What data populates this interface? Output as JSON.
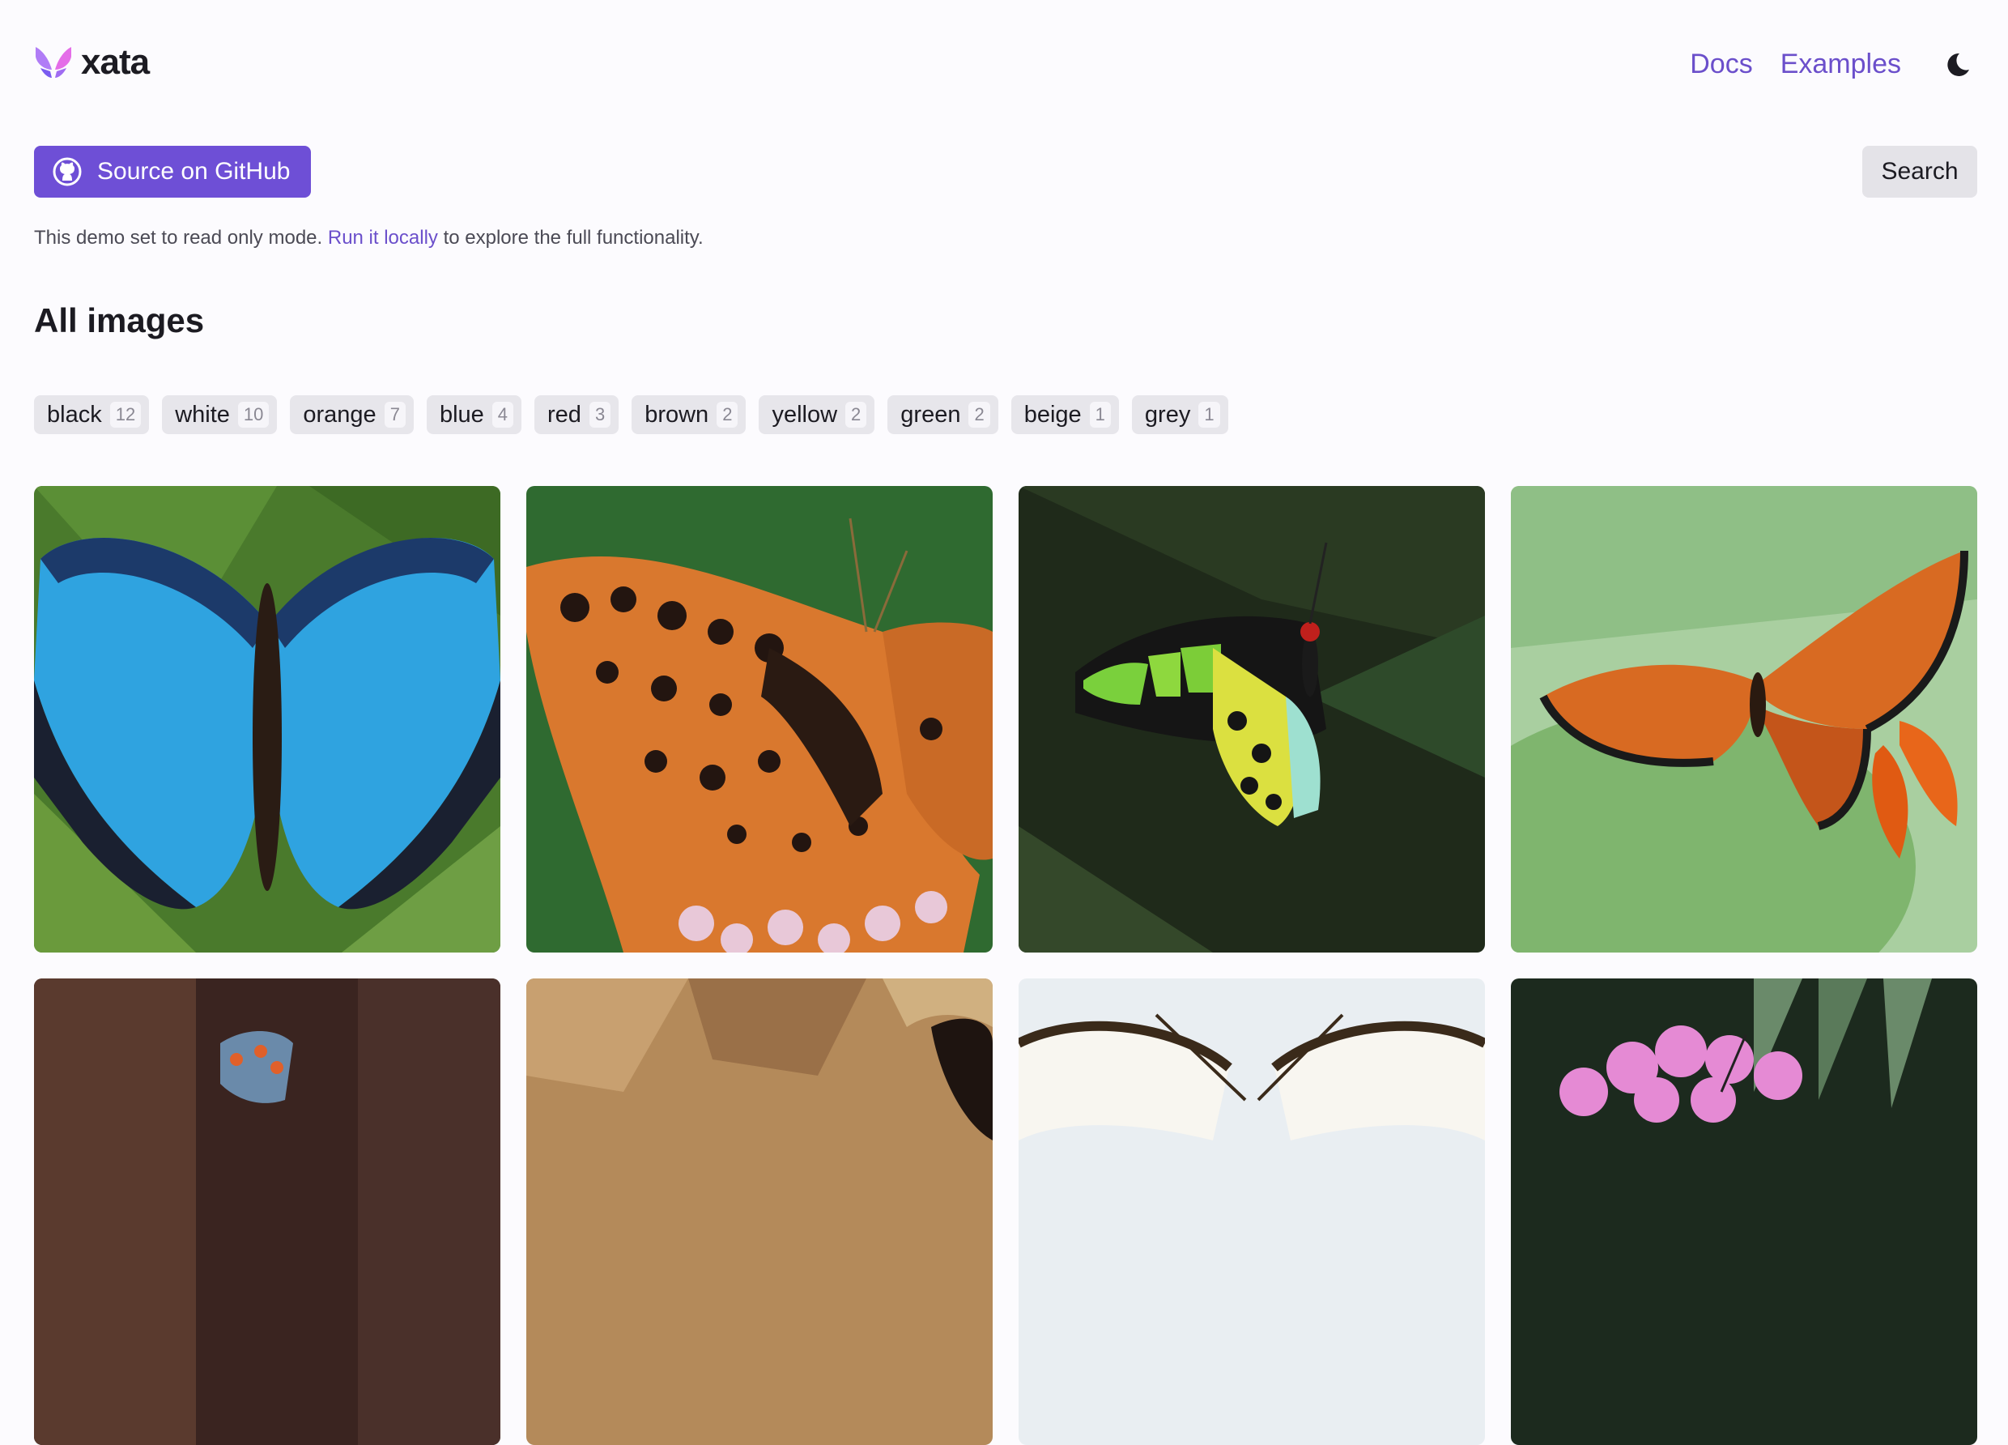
{
  "header": {
    "logo_text": "xata",
    "nav": [
      {
        "label": "Docs"
      },
      {
        "label": "Examples"
      }
    ],
    "theme_icon": "moon-icon"
  },
  "actions": {
    "github_label": "Source on GitHub",
    "github_icon": "github-icon",
    "search_label": "Search"
  },
  "notice": {
    "before": "This demo set to read only mode.",
    "link": "Run it locally",
    "after": "to explore the full functionality."
  },
  "heading": "All images",
  "tags": [
    {
      "label": "black",
      "count": "12"
    },
    {
      "label": "white",
      "count": "10"
    },
    {
      "label": "orange",
      "count": "7"
    },
    {
      "label": "blue",
      "count": "4"
    },
    {
      "label": "red",
      "count": "3"
    },
    {
      "label": "brown",
      "count": "2"
    },
    {
      "label": "yellow",
      "count": "2"
    },
    {
      "label": "green",
      "count": "2"
    },
    {
      "label": "beige",
      "count": "1"
    },
    {
      "label": "grey",
      "count": "1"
    }
  ],
  "images": [
    {
      "subject": "blue morpho butterfly"
    },
    {
      "subject": "orange fritillary butterfly"
    },
    {
      "subject": "green and yellow birdwing butterfly"
    },
    {
      "subject": "queen butterfly on leaf"
    },
    {
      "subject": "butterfly on dark background"
    },
    {
      "subject": "butterfly on brown leaves"
    },
    {
      "subject": "white butterfly"
    },
    {
      "subject": "butterfly on pink flower"
    }
  ],
  "colors": {
    "accent": "#6e4fd6",
    "link": "#6b4fcb",
    "background": "#fcfbfe",
    "tag_bg": "#e7e6eb"
  }
}
